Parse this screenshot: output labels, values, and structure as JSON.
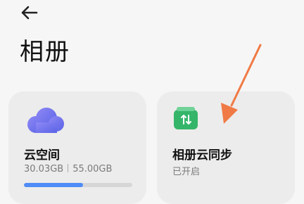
{
  "header": {
    "back_icon": "arrow-left-icon",
    "title": "相册"
  },
  "cards": {
    "cloud_space": {
      "icon": "cloud-icon",
      "title": "云空间",
      "used": "30.03GB",
      "total": "55.00GB",
      "usage_fraction": 0.546,
      "accent": "#4f8cf7"
    },
    "album_sync": {
      "icon": "sync-arrows-icon",
      "title": "相册云同步",
      "status": "已开启",
      "accent": "#34b56a"
    }
  },
  "annotation": {
    "icon": "pointer-arrow-icon",
    "color": "#f07a45"
  }
}
